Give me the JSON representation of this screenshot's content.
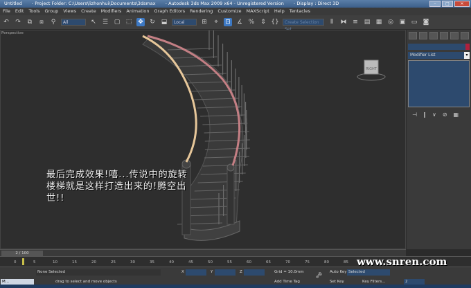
{
  "title": {
    "doc": "Untitled",
    "folder": "- Project Folder: C:\\Users\\lizhonhui\\Documents\\3dsmax",
    "app": "- Autodesk 3ds Max  2009 x64  - Unregistered Version",
    "display": "- Display : Direct 3D"
  },
  "menu": [
    "File",
    "Edit",
    "Tools",
    "Group",
    "Views",
    "Create",
    "Modifiers",
    "Animation",
    "Graph Editors",
    "Rendering",
    "Customize",
    "MAXScript",
    "Help",
    "Tentacles"
  ],
  "toolbar": {
    "filter": "All",
    "coord": "Local",
    "named_sel": "Create Selection Set"
  },
  "viewport": {
    "label": "Perspective",
    "overlay_text": "最后完成效果!嘻...传说中的旋转楼梯就是这样打造出来的!腾空出世!!",
    "viewcube": "RIGHT"
  },
  "command_panel": {
    "modifier_list": "Modifier List",
    "color_swatch": "#b0203c"
  },
  "time": {
    "slider": "2 / 100",
    "ticks": [
      0,
      5,
      10,
      15,
      20,
      25,
      30,
      35,
      40,
      45,
      50,
      55,
      60,
      65,
      70,
      75,
      80,
      85,
      90
    ]
  },
  "status": {
    "selection": "None Selected",
    "prompt": "drag to select and move objects",
    "x_label": "X",
    "y_label": "Y",
    "z_label": "Z",
    "grid": "Grid = 10.0mm",
    "add_time_tag": "Add Time Tag",
    "auto_key": "Auto Key",
    "set_key": "Set Key",
    "key_mode": "Selected",
    "key_filters": "Key Filters...",
    "frame": "2",
    "mini_listener": "M..."
  },
  "watermark": "www.snren.com"
}
